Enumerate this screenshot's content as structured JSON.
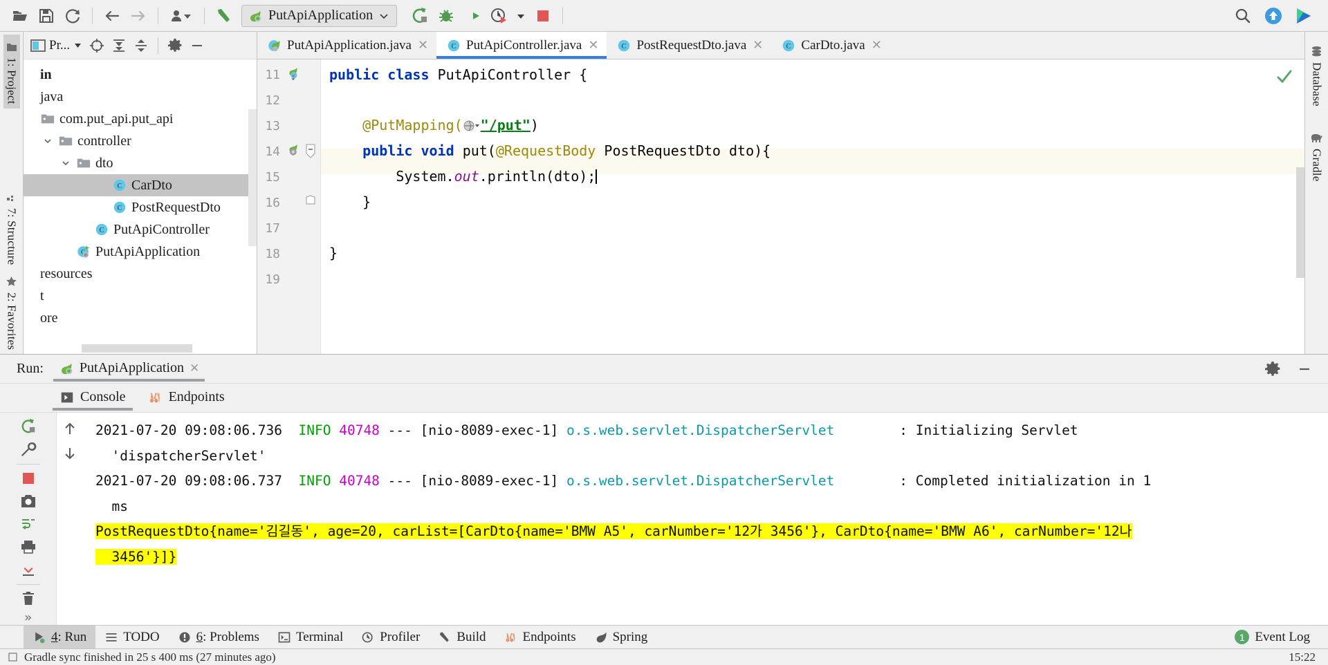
{
  "toolbar": {
    "open_label": "open-folder",
    "save_label": "save-all",
    "sync_label": "sync",
    "back_label": "back",
    "forward_label": "forward",
    "vcs_label": "vcs-update",
    "build_label": "build",
    "run_config_name": "PutApiApplication",
    "run_label": "run",
    "debug_label": "debug",
    "run_coverage_label": "run-with-coverage",
    "profiler_label": "profiler",
    "stop_label": "stop",
    "search_label": "search-everywhere",
    "update_label": "update",
    "ide_label": "ide-logo"
  },
  "left_rail": {
    "project": "1: Project",
    "structure": "7: Structure",
    "favorites": "2: Favorites"
  },
  "right_rail": {
    "database": "Database",
    "gradle": "Gradle"
  },
  "project_panel": {
    "title": "Pr...",
    "tree": [
      {
        "label": "in",
        "indent": 0,
        "arrow": "",
        "icon": "none",
        "bold": true,
        "selected": false
      },
      {
        "label": "java",
        "indent": 0,
        "arrow": "",
        "icon": "none",
        "bold": false,
        "selected": false
      },
      {
        "label": "com.put_api.put_api",
        "indent": 0,
        "arrow": "",
        "icon": "package",
        "bold": false,
        "selected": false
      },
      {
        "label": "controller",
        "indent": 1,
        "arrow": "v",
        "icon": "package",
        "bold": false,
        "selected": false
      },
      {
        "label": "dto",
        "indent": 2,
        "arrow": "v",
        "icon": "package",
        "bold": false,
        "selected": false
      },
      {
        "label": "CarDto",
        "indent": 4,
        "arrow": "",
        "icon": "class",
        "bold": false,
        "selected": true
      },
      {
        "label": "PostRequestDto",
        "indent": 4,
        "arrow": "",
        "icon": "class",
        "bold": false,
        "selected": false
      },
      {
        "label": "PutApiController",
        "indent": 3,
        "arrow": "",
        "icon": "class",
        "bold": false,
        "selected": false
      },
      {
        "label": "PutApiApplication",
        "indent": 2,
        "arrow": "",
        "icon": "springboot",
        "bold": false,
        "selected": false
      },
      {
        "label": "resources",
        "indent": 0,
        "arrow": "",
        "icon": "none",
        "bold": false,
        "selected": false
      },
      {
        "label": "t",
        "indent": 0,
        "arrow": "",
        "icon": "none",
        "bold": false,
        "selected": false
      },
      {
        "label": "ore",
        "indent": 0,
        "arrow": "",
        "icon": "none",
        "bold": false,
        "selected": false
      }
    ]
  },
  "editor": {
    "tabs": [
      {
        "label": "PutApiApplication.java",
        "icon": "springboot-class",
        "active": false
      },
      {
        "label": "PutApiController.java",
        "icon": "class",
        "active": true
      },
      {
        "label": "PostRequestDto.java",
        "icon": "class",
        "active": false
      },
      {
        "label": "CarDto.java",
        "icon": "class",
        "active": false
      }
    ],
    "lines": [
      {
        "num": "11",
        "gutter_icon": "bean-class",
        "fold": "",
        "highlight": false
      },
      {
        "num": "12",
        "gutter_icon": "",
        "fold": "",
        "highlight": false
      },
      {
        "num": "13",
        "gutter_icon": "",
        "fold": "",
        "highlight": false
      },
      {
        "num": "14",
        "gutter_icon": "bean-method",
        "fold": "minus",
        "highlight": false
      },
      {
        "num": "15",
        "gutter_icon": "",
        "fold": "",
        "highlight": true
      },
      {
        "num": "16",
        "gutter_icon": "",
        "fold": "end",
        "highlight": false
      },
      {
        "num": "17",
        "gutter_icon": "",
        "fold": "",
        "highlight": false
      },
      {
        "num": "18",
        "gutter_icon": "",
        "fold": "",
        "highlight": false
      },
      {
        "num": "19",
        "gutter_icon": "",
        "fold": "",
        "highlight": false
      }
    ],
    "code": {
      "l11_kw1": "public",
      "l11_kw2": "class",
      "l11_name": "PutApiController {",
      "l13_indent": "    ",
      "l13_ann": "@PutMapping(",
      "l13_path": "\"/put\"",
      "l13_close": ")",
      "l14_kw1": "public",
      "l14_kw2": "void",
      "l14_sig1": "put(",
      "l14_ann": "@RequestBody",
      "l14_sig2": " PostRequestDto dto){",
      "l15_pre": "System.",
      "l15_fld": "out",
      "l15_post": ".println(dto);",
      "l16": "}",
      "l18": "}"
    },
    "inspection_status": "ok-checkmark"
  },
  "run_panel": {
    "run_label": "Run:",
    "config_tab": "PutApiApplication",
    "subtabs": [
      {
        "label": "Console",
        "icon": "console-icon",
        "active": true
      },
      {
        "label": "Endpoints",
        "icon": "endpoints-icon",
        "active": false
      }
    ],
    "settings_label": "settings",
    "minimize_label": "minimize",
    "side_buttons": [
      "rerun-icon",
      "wrench-icon",
      "stop-icon",
      "camera-icon",
      "print-icon",
      "soft-wrap-icon",
      "scroll-to-end-icon",
      "up-icon",
      "down-icon",
      "trash-icon",
      "more-icon"
    ],
    "console": [
      {
        "segments": [
          {
            "t": "2021-07-20 09:08:06.736  ",
            "c": "txt"
          },
          {
            "t": "INFO",
            "c": "info"
          },
          {
            "t": " ",
            "c": "txt"
          },
          {
            "t": "40748",
            "c": "pid"
          },
          {
            "t": " --- [nio-8089-exec-1] ",
            "c": "txt"
          },
          {
            "t": "o.s.web.servlet.DispatcherServlet",
            "c": "logger"
          },
          {
            "t": "        : Initializing Servlet",
            "c": "txt"
          }
        ]
      },
      {
        "segments": [
          {
            "t": "  'dispatcherServlet'",
            "c": "txt"
          }
        ]
      },
      {
        "segments": [
          {
            "t": "2021-07-20 09:08:06.737  ",
            "c": "txt"
          },
          {
            "t": "INFO",
            "c": "info"
          },
          {
            "t": " ",
            "c": "txt"
          },
          {
            "t": "40748",
            "c": "pid"
          },
          {
            "t": " --- [nio-8089-exec-1] ",
            "c": "txt"
          },
          {
            "t": "o.s.web.servlet.DispatcherServlet",
            "c": "logger"
          },
          {
            "t": "        : Completed initialization in 1",
            "c": "txt"
          }
        ]
      },
      {
        "segments": [
          {
            "t": "  ms",
            "c": "txt"
          }
        ]
      },
      {
        "highlight": true,
        "segments": [
          {
            "t": "PostRequestDto{name='김길동', age=20, carList=[CarDto{name='BMW A5', carNumber='12가 3456'}, CarDto{name='BMW A6', carNumber='12나",
            "c": "txt"
          }
        ]
      },
      {
        "highlight": true,
        "segments": [
          {
            "t": "  3456'}]}",
            "c": "txt"
          }
        ]
      }
    ]
  },
  "tool_window_bar": {
    "items": [
      {
        "label": "4: Run",
        "icon": "run-icon",
        "active": true,
        "underline_index": 0
      },
      {
        "label": "TODO",
        "icon": "todo-icon",
        "active": false,
        "underline_index": -1
      },
      {
        "label": "6: Problems",
        "icon": "problems-icon",
        "active": false,
        "underline_index": 0
      },
      {
        "label": "Terminal",
        "icon": "terminal-icon",
        "active": false,
        "underline_index": -1
      },
      {
        "label": "Profiler",
        "icon": "profiler-icon",
        "active": false,
        "underline_index": -1
      },
      {
        "label": "Build",
        "icon": "build-icon",
        "active": false,
        "underline_index": -1
      },
      {
        "label": "Endpoints",
        "icon": "endpoints-icon",
        "active": false,
        "underline_index": -1
      },
      {
        "label": "Spring",
        "icon": "spring-icon",
        "active": false,
        "underline_index": -1
      }
    ],
    "event_log": "Event Log",
    "event_log_count": "1"
  },
  "status_bar": {
    "message": "Gradle sync finished in 25 s 400 ms (27 minutes ago)",
    "time": "15:22"
  },
  "colors": {
    "accent_blue": "#3b7ddd",
    "green": "#59a869",
    "red": "#e05555",
    "highlight_yellow": "#ffff00",
    "keyword_blue": "#0033b3",
    "string_green": "#067d17",
    "annotation_gold": "#9e880d",
    "logger_teal": "#0d9aa8",
    "pid_magenta": "#cc00cc"
  }
}
